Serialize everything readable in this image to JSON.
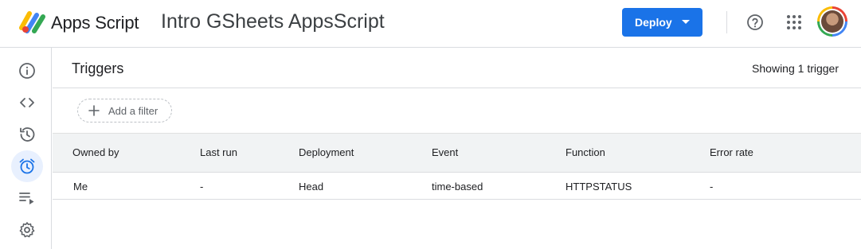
{
  "header": {
    "app_name": "Apps Script",
    "project_title": "Intro GSheets AppsScript",
    "deploy_label": "Deploy"
  },
  "sidenav": {
    "items": [
      {
        "icon": "info-icon"
      },
      {
        "icon": "code-icon"
      },
      {
        "icon": "history-icon"
      },
      {
        "icon": "alarm-clock-icon",
        "active": true
      },
      {
        "icon": "executions-icon"
      },
      {
        "icon": "gear-icon"
      }
    ]
  },
  "main": {
    "title": "Triggers",
    "trigger_count": "Showing 1 trigger",
    "filter_label": "Add a filter"
  },
  "table": {
    "columns": [
      "Owned by",
      "Last run",
      "Deployment",
      "Event",
      "Function",
      "Error rate"
    ],
    "rows": [
      [
        "Me",
        "-",
        "Head",
        "time-based",
        "HTTPSTATUS",
        "-"
      ]
    ]
  },
  "colors": {
    "accent": "#1a73e8",
    "active_nav_bg": "#e8f0fe",
    "header_row_bg": "#f1f3f4"
  }
}
